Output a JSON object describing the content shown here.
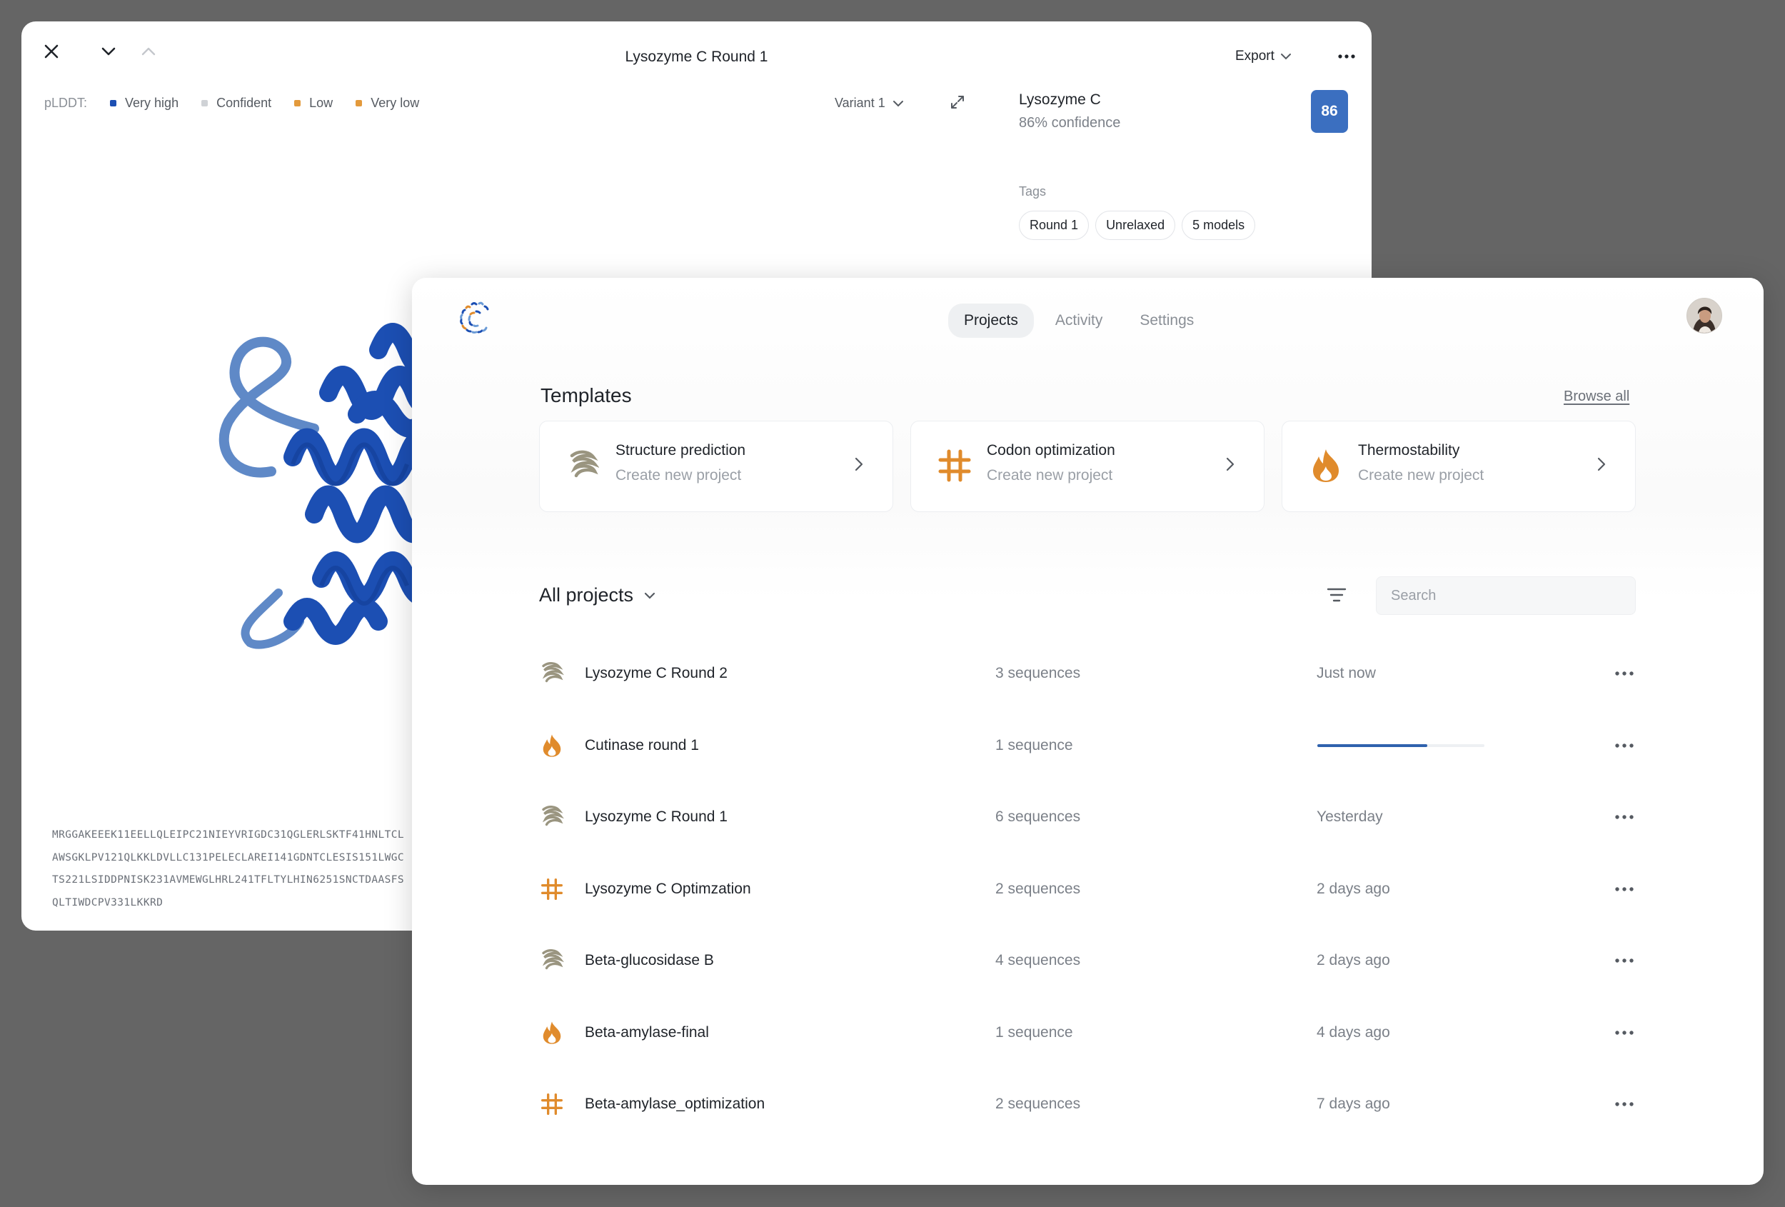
{
  "colors": {
    "accent_blue": "#3b6fc0",
    "orange": "#e08b2c",
    "khaki": "#9a9580",
    "progress": "#2f62ad"
  },
  "viewer": {
    "title": "Lysozyme C Round 1",
    "export_label": "Export",
    "legend": {
      "label": "pLDDT:",
      "items": [
        {
          "label": "Very high",
          "color": "#1c4fb3"
        },
        {
          "label": "Confident",
          "color": "#cfd2d6"
        },
        {
          "label": "Low",
          "color": "#e39a3c"
        },
        {
          "label": "Very low",
          "color": "#e39a3c"
        }
      ]
    },
    "variant": "Variant 1",
    "protein": {
      "name": "Lysozyme C",
      "confidence": "86% confidence",
      "score": "86"
    },
    "tags_label": "Tags",
    "tags": [
      "Round 1",
      "Unrelaxed",
      "5 models"
    ],
    "sequence": [
      "MRGGAKEEEK11EELLQLEIPC21NIEYVRIGDC31QGLERLSKTF41HNLTCL",
      "AWSGKLPV121QLKKLDVLLC131PELECLAREI141GDNTCLESIS151LWGC",
      "TS221LSIDDPNISK231AVMEWGLHRL241TFLTYLHIN6251SNCTDAASFS",
      "QLTIWDCPV331LKKRD"
    ]
  },
  "app": {
    "nav": [
      "Projects",
      "Activity",
      "Settings"
    ],
    "active_nav": "Projects",
    "templates_title": "Templates",
    "browse_all": "Browse all",
    "templates": [
      {
        "title": "Structure prediction",
        "subtitle": "Create new project",
        "icon": "helix-icon"
      },
      {
        "title": "Codon optimization",
        "subtitle": "Create new project",
        "icon": "hash-icon"
      },
      {
        "title": "Thermostability",
        "subtitle": "Create new project",
        "icon": "flame-icon"
      }
    ],
    "projects_title": "All projects",
    "search_placeholder": "Search",
    "projects": [
      {
        "name": "Lysozyme C Round 2",
        "sequences": "3 sequences",
        "time": "Just now",
        "icon": "helix-icon"
      },
      {
        "name": "Cutinase round 1",
        "sequences": "1 sequence",
        "time": "",
        "progress": 0.66,
        "icon": "flame-icon"
      },
      {
        "name": "Lysozyme C Round 1",
        "sequences": "6 sequences",
        "time": "Yesterday",
        "icon": "helix-icon"
      },
      {
        "name": "Lysozyme C Optimzation",
        "sequences": "2 sequences",
        "time": "2 days ago",
        "icon": "hash-icon"
      },
      {
        "name": "Beta-glucosidase B",
        "sequences": "4 sequences",
        "time": "2 days ago",
        "icon": "helix-icon"
      },
      {
        "name": "Beta-amylase-final",
        "sequences": "1 sequence",
        "time": "4 days ago",
        "icon": "flame-icon"
      },
      {
        "name": "Beta-amylase_optimization",
        "sequences": "2 sequences",
        "time": "7 days ago",
        "icon": "hash-icon"
      }
    ]
  }
}
